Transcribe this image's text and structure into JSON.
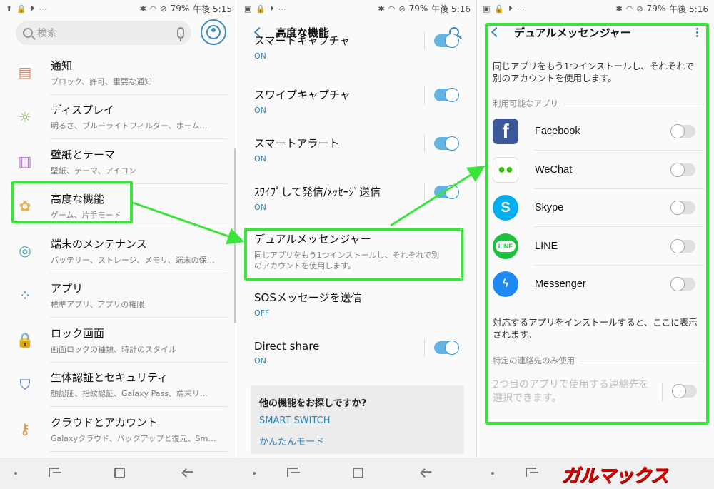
{
  "status": {
    "battery": "79%",
    "time_left": "午後 5:15",
    "time_mid": "午後 5:16",
    "time_right": "午後 5:16"
  },
  "settings": {
    "search_placeholder": "検索",
    "items": [
      {
        "title": "通知",
        "sub": "ブロック、許可、重要な通知",
        "icon": "notification-icon",
        "color": "#e58a70"
      },
      {
        "title": "ディスプレイ",
        "sub": "明るさ、ブルーライトフィルター、ホーム…",
        "icon": "display-icon",
        "color": "#8dbf4a"
      },
      {
        "title": "壁紙とテーマ",
        "sub": "壁紙、テーマ、アイコン",
        "icon": "paintbrush-icon",
        "color": "#b07ac5"
      },
      {
        "title": "高度な機能",
        "sub": "ゲーム、片手モード",
        "icon": "advanced-gear-icon",
        "color": "#e8b048"
      },
      {
        "title": "端末のメンテナンス",
        "sub": "バッテリー、ストレージ、メモリ、端末の保…",
        "icon": "maintenance-icon",
        "color": "#3fa9b8"
      },
      {
        "title": "アプリ",
        "sub": "標準アプリ、アプリの権限",
        "icon": "apps-grid-icon",
        "color": "#4a8fd6"
      },
      {
        "title": "ロック画面",
        "sub": "画面ロックの種類、時計のスタイル",
        "icon": "lock-icon",
        "color": "#8a72c8"
      },
      {
        "title": "生体認証とセキュリティ",
        "sub": "顔認証、指紋認証、Galaxy Pass、端末リ…",
        "icon": "shield-icon",
        "color": "#4d6fc7"
      },
      {
        "title": "クラウドとアカウント",
        "sub": "Galaxyクラウド、バックアップと復元、Sm…",
        "icon": "key-icon",
        "color": "#e29a3e"
      }
    ]
  },
  "advanced": {
    "title": "高度な機能",
    "items": [
      {
        "title": "スマートキャプチャ",
        "status": "ON",
        "toggle": "on"
      },
      {
        "title": "スワイプキャプチャ",
        "status": "ON",
        "toggle": "on"
      },
      {
        "title": "スマートアラート",
        "status": "ON",
        "toggle": "on"
      },
      {
        "title": "ｽﾜｲﾌﾟして発信/ﾒｯｾｰｼﾞ送信",
        "status": "ON",
        "toggle": "on"
      },
      {
        "title": "デュアルメッセンジャー",
        "sub": "同じアプリをもう1つインストールし、それぞれで別のアカウントを使用します。",
        "toggle": "none"
      },
      {
        "title": "SOSメッセージを送信",
        "status": "OFF",
        "toggle": "none"
      },
      {
        "title": "Direct share",
        "status": "ON",
        "toggle": "on"
      }
    ],
    "suggest": {
      "question": "他の機能をお探しですか?",
      "link1": "SMART SWITCH",
      "link2": "かんたんモード"
    }
  },
  "dual": {
    "title": "デュアルメッセンジャー",
    "desc": "同じアプリをもう1つインストールし、それぞれで別のアカウントを使用します。",
    "section_available": "利用可能なアプリ",
    "apps": [
      {
        "name": "Facebook",
        "icon": "facebook-icon",
        "color": "#3b5998"
      },
      {
        "name": "WeChat",
        "icon": "wechat-icon",
        "color": "#2dc100"
      },
      {
        "name": "Skype",
        "icon": "skype-icon",
        "color": "#00aff0"
      },
      {
        "name": "LINE",
        "icon": "line-icon",
        "color": "#19c13e"
      },
      {
        "name": "Messenger",
        "icon": "messenger-icon",
        "color": "#1e88f5"
      }
    ],
    "note": "対応するアプリをインストールすると、ここに表示されます。",
    "section_contacts": "特定の連絡先のみ使用",
    "contacts_desc": "2つ目のアプリで使用する連絡先を選択できます。"
  },
  "watermark": "ガルマックス",
  "accent": "#3ae43a"
}
